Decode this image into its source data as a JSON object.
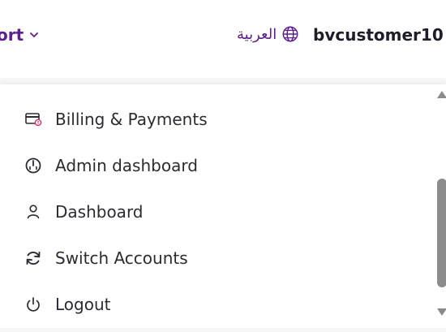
{
  "header": {
    "support_label": "ort",
    "language_label": "العربية",
    "username": "bvcustomer10"
  },
  "menu": {
    "items": [
      {
        "label": "Billing & Payments",
        "icon": "billing-card-icon"
      },
      {
        "label": "Admin dashboard",
        "icon": "gauge-icon"
      },
      {
        "label": "Dashboard",
        "icon": "user-icon"
      },
      {
        "label": "Switch Accounts",
        "icon": "refresh-icon"
      },
      {
        "label": "Logout",
        "icon": "power-icon"
      }
    ]
  },
  "colors": {
    "accent": "#5b1f8f",
    "text": "#2b2b33",
    "username": "#1e1e2a",
    "billing_badge": "#e0245e"
  }
}
